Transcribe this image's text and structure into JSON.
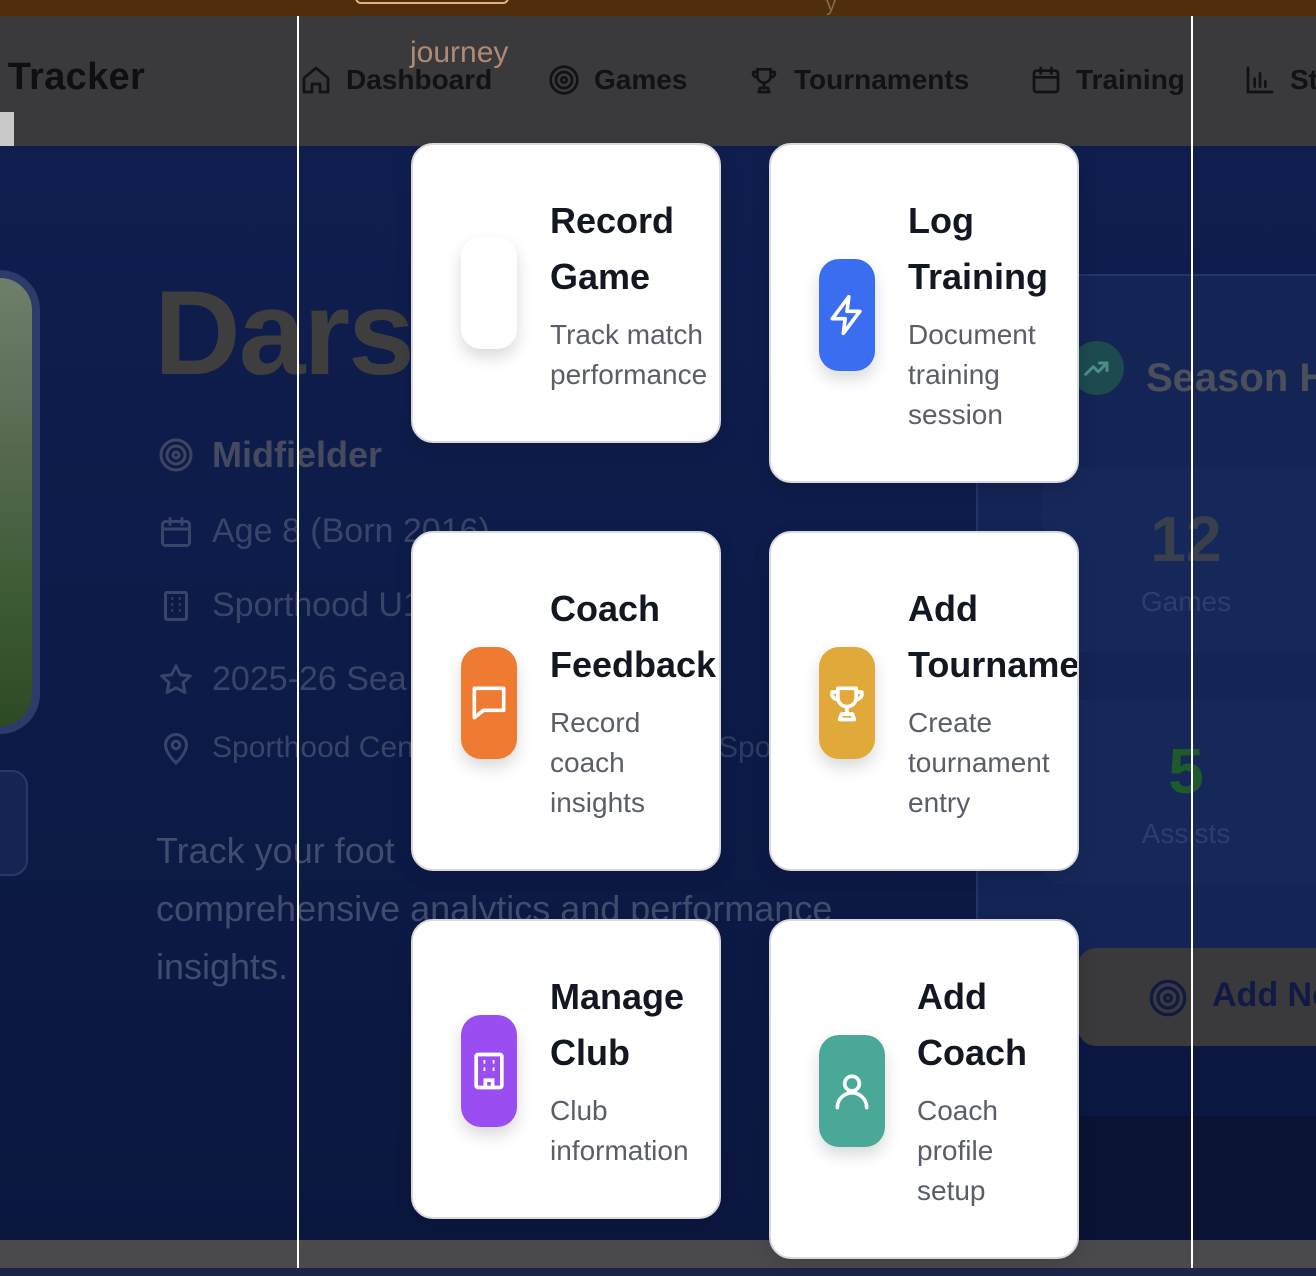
{
  "app": {
    "title": "l Tracker",
    "nav_subtitle": "journey"
  },
  "nav": [
    {
      "label": "Dashboard",
      "icon": "home-icon"
    },
    {
      "label": "Games",
      "icon": "target-icon"
    },
    {
      "label": "Tournaments",
      "icon": "trophy-icon"
    },
    {
      "label": "Training",
      "icon": "calendar-icon"
    },
    {
      "label": "St",
      "icon": "bar-chart-icon"
    }
  ],
  "player": {
    "name": "Dars",
    "position": "Midfielder",
    "age": "Age 8 (Born 2016)",
    "club": "Sporthood U1",
    "season": "2025-26 Sea",
    "location": "Sporthood Cen",
    "location_extra": "Spor",
    "tagline_1": "Track your foot",
    "tagline_2": "comprehensive analytics and performance",
    "tagline_3": "insights."
  },
  "season": {
    "title": "Season H",
    "stats": [
      {
        "value": "12",
        "label": "Games",
        "color": "#3a3f4d"
      },
      {
        "value": "5",
        "label": "Assists",
        "color": "#1f5a2a"
      }
    ],
    "add_new_label": "Add Ne"
  },
  "quick_actions": [
    {
      "title_1": "Record",
      "title_2": "Game",
      "desc_1": "Track match",
      "desc_2": "performance",
      "desc_3": "",
      "icon": "blank-icon",
      "color": "#ffffff"
    },
    {
      "title_1": "Log",
      "title_2": "Training",
      "desc_1": "Document",
      "desc_2": "training",
      "desc_3": "session",
      "icon": "lightning-icon",
      "color": "#3b6df0"
    },
    {
      "title_1": "Coach",
      "title_2": "Feedback",
      "desc_1": "Record",
      "desc_2": "coach",
      "desc_3": "insights",
      "icon": "chat-bubble-icon",
      "color": "#ef7a31"
    },
    {
      "title_1": "Add",
      "title_2": "Tournament",
      "desc_1": "Create",
      "desc_2": "tournament",
      "desc_3": "entry",
      "icon": "trophy-icon",
      "color": "#e0a93a"
    },
    {
      "title_1": "Manage",
      "title_2": "Club",
      "desc_1": "Club",
      "desc_2": "information",
      "desc_3": "",
      "icon": "building-icon",
      "color": "#9a4df0"
    },
    {
      "title_1": "Add",
      "title_2": "Coach",
      "desc_1": "Coach",
      "desc_2": "profile",
      "desc_3": "setup",
      "icon": "user-icon",
      "color": "#4aa899"
    }
  ]
}
